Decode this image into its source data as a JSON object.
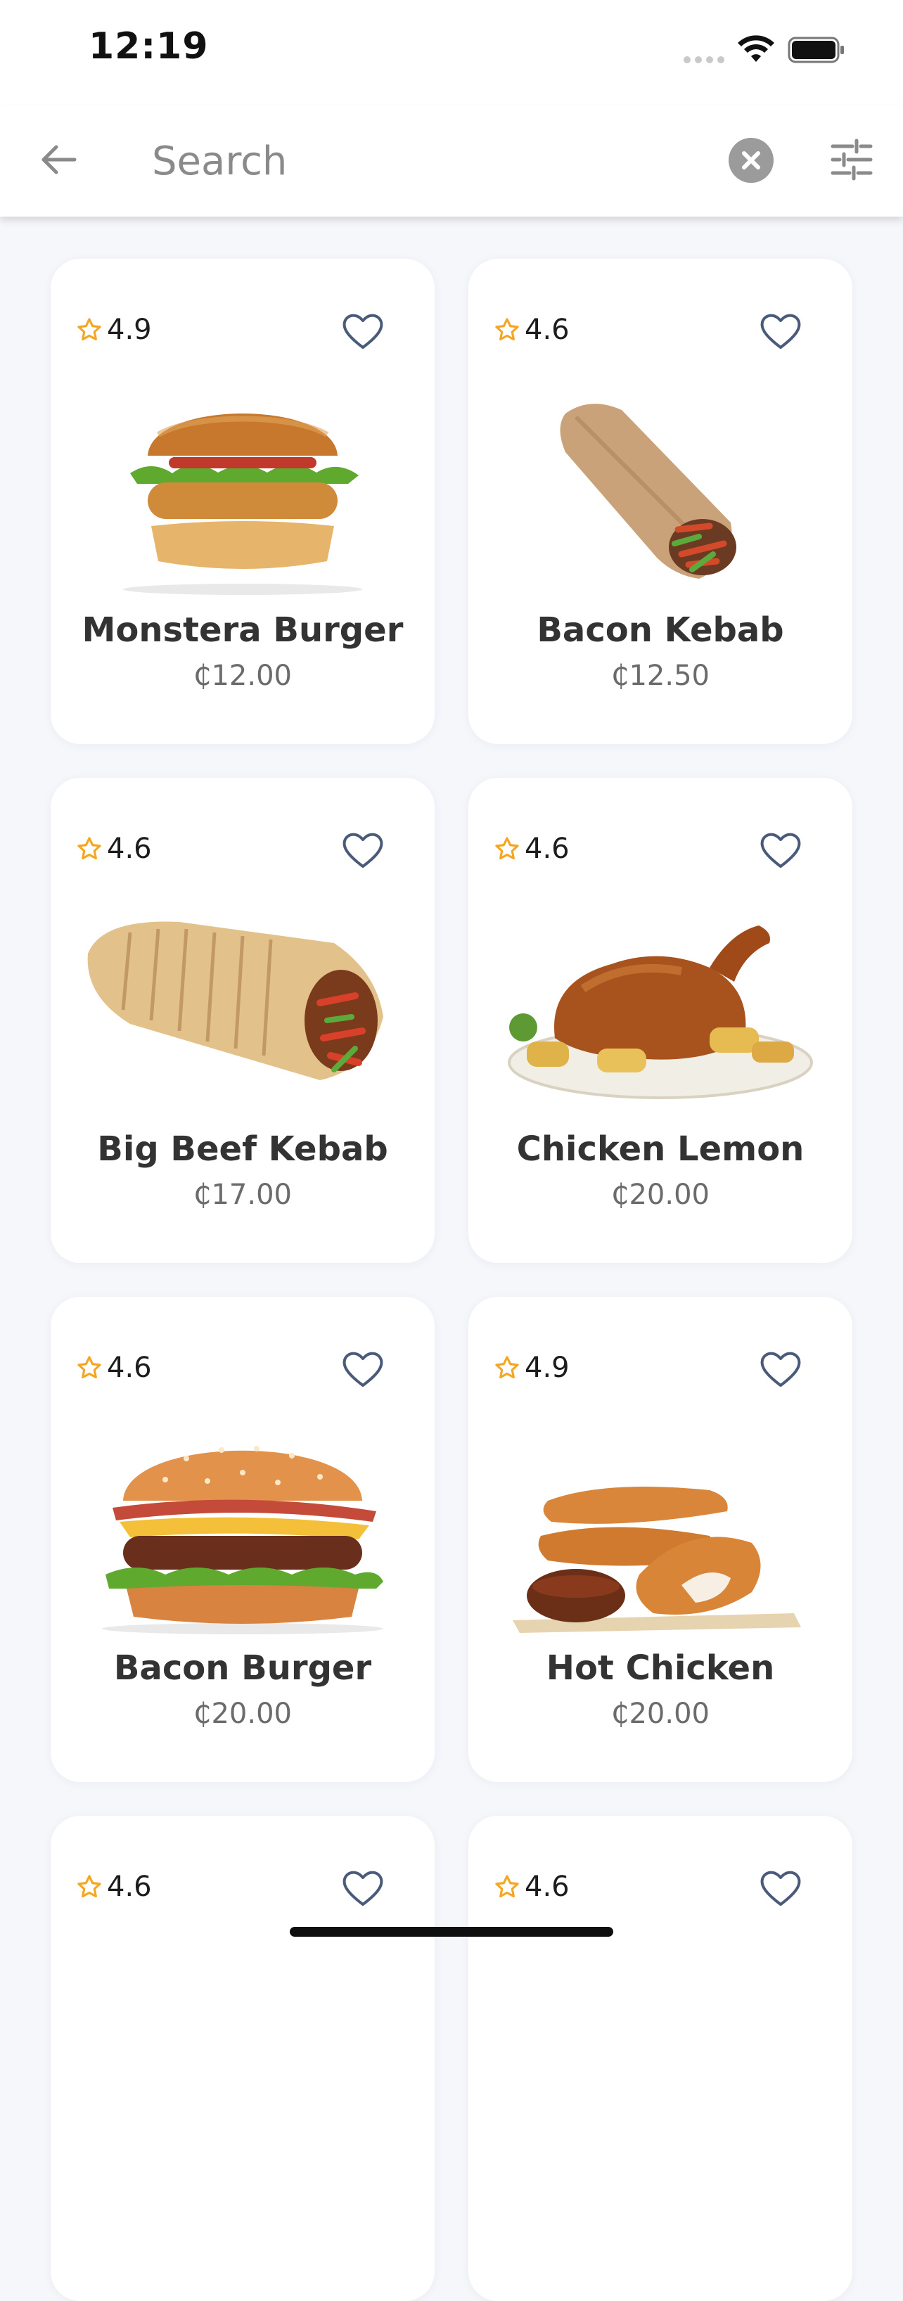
{
  "status_bar": {
    "time": "12:19"
  },
  "search": {
    "placeholder": "Search"
  },
  "items": [
    {
      "name": "Monstera Burger",
      "price": "₵12.00",
      "rating": "4.9",
      "image_icon": "burger-icon"
    },
    {
      "name": "Bacon Kebab",
      "price": "₵12.50",
      "rating": "4.6",
      "image_icon": "wrap-icon"
    },
    {
      "name": "Big Beef Kebab",
      "price": "₵17.00",
      "rating": "4.6",
      "image_icon": "wrap-icon"
    },
    {
      "name": "Chicken Lemon",
      "price": "₵20.00",
      "rating": "4.6",
      "image_icon": "roast-chicken-icon"
    },
    {
      "name": "Bacon Burger",
      "price": "₵20.00",
      "rating": "4.6",
      "image_icon": "burger-icon"
    },
    {
      "name": "Hot Chicken",
      "price": "₵20.00",
      "rating": "4.9",
      "image_icon": "chicken-tenders-icon"
    },
    {
      "name": "",
      "price": "",
      "rating": "4.6",
      "image_icon": ""
    },
    {
      "name": "",
      "price": "",
      "rating": "4.6",
      "image_icon": ""
    }
  ],
  "colors": {
    "star": "#f5a623",
    "accent": "#4a5a7a",
    "background": "#f6f7fb"
  }
}
